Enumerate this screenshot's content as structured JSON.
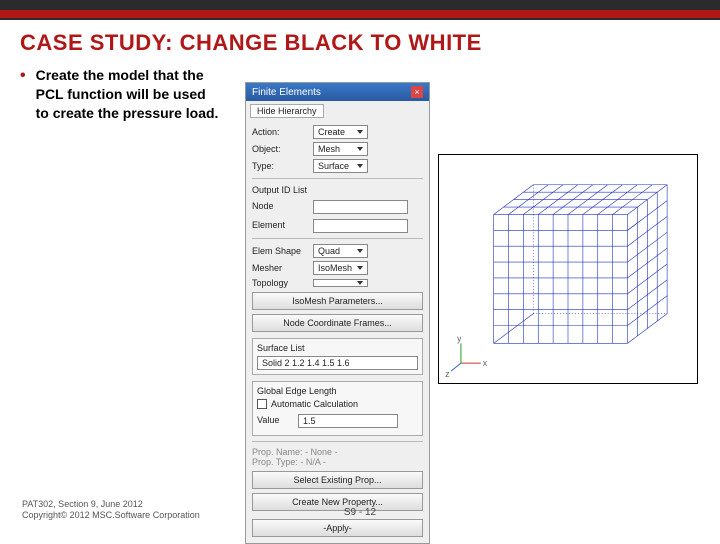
{
  "title": "CASE STUDY: CHANGE BLACK TO WHITE",
  "bullet_text": "Create the model that the PCL function will be used to create the pressure load.",
  "panel": {
    "window_title": "Finite Elements",
    "tab": "Hide Hierarchy",
    "action_label": "Action:",
    "action_value": "Create",
    "object_label": "Object:",
    "object_value": "Mesh",
    "type_label": "Type:",
    "type_value": "Surface",
    "output_ids_label": "Output ID List",
    "node_label": "Node",
    "node_value": "",
    "element_label": "Element",
    "element_value": "",
    "elem_shape_label": "Elem Shape",
    "elem_shape_value": "Quad",
    "mesher_label": "Mesher",
    "mesher_value": "IsoMesh",
    "topology_label": "Topology",
    "topology_value": "",
    "btn_iso_params": "IsoMesh Parameters...",
    "btn_node_seeds": "Node Coordinate Frames...",
    "surface_list_label": "Surface List",
    "surface_list_value": "Solid 2 1.2 1.4 1.5 1.6",
    "edge_len_title": "Global Edge Length",
    "auto_calc_label": "Automatic Calculation",
    "value_label": "Value",
    "value_value": "1.5",
    "prop_label": "Prop. Name:  - None -",
    "prop_type_label": "Prop. Type:  - N/A -",
    "btn_select_prop": "Select Existing Prop...",
    "btn_create_prop": "Create New Property...",
    "btn_apply": "-Apply-"
  },
  "footer": {
    "line1": "PAT302, Section 9, June 2012",
    "line2": "Copyright© 2012 MSC.Software Corporation",
    "page": "S9 - 12"
  }
}
